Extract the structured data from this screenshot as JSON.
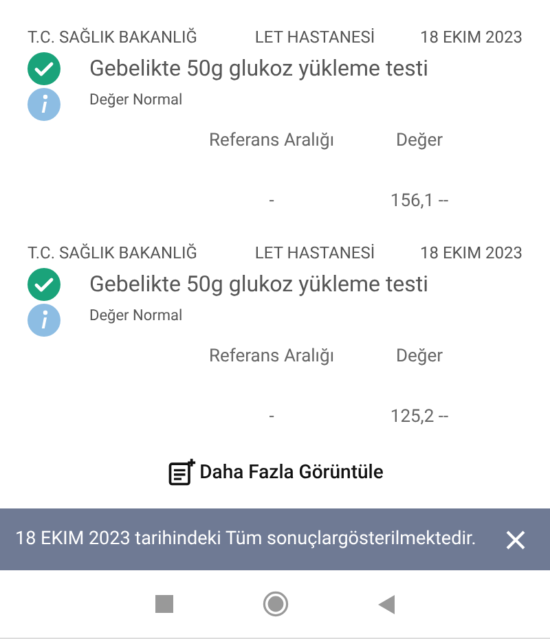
{
  "results": [
    {
      "institution_start": "T.C. SAĞLIK BAKANLIĞ",
      "institution_end": "LET HASTANESİ",
      "date": "18 EKIM 2023",
      "test": "Gebelikte 50g glukoz yükleme testi",
      "status": "Değer Normal",
      "columns": [
        "Referans Aralığı",
        "Değer"
      ],
      "values": [
        "-",
        "156,1 --"
      ]
    },
    {
      "institution_start": "T.C. SAĞLIK BAKANLIĞ",
      "institution_end": "LET HASTANESİ",
      "date": "18 EKIM 2023",
      "test": "Gebelikte 50g glukoz yükleme testi",
      "status": "Değer Normal",
      "columns": [
        "Referans Aralığı",
        "Değer"
      ],
      "values": [
        "-",
        "125,2 --"
      ]
    }
  ],
  "more_button": "Daha Fazla Görüntüle",
  "snackbar": {
    "message": "18 EKIM 2023 tarihindeki Tüm sonuçlargösterilmektedir."
  }
}
